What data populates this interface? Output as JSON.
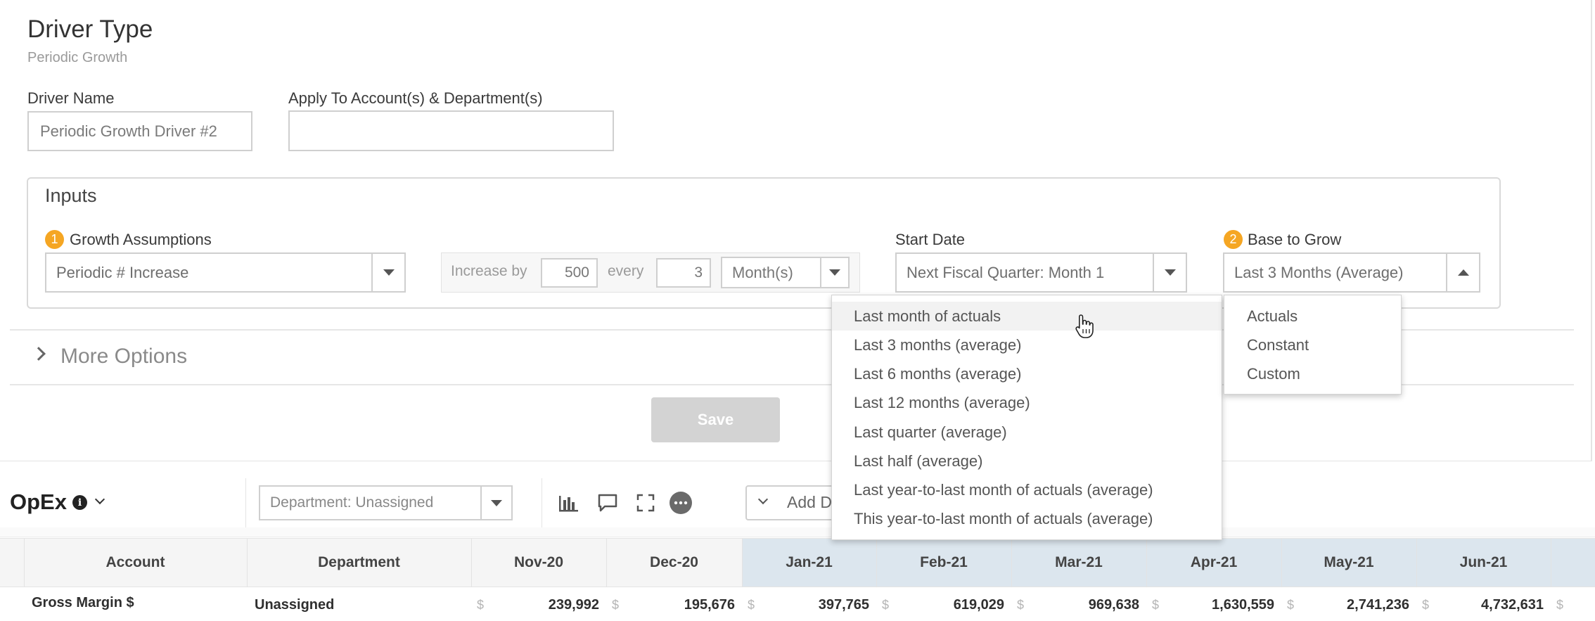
{
  "header": {
    "title": "Driver Type",
    "subtitle": "Periodic Growth"
  },
  "driver_name": {
    "label": "Driver Name",
    "value": "Periodic Growth Driver #2"
  },
  "apply_to": {
    "label": "Apply To Account(s) & Department(s)",
    "value": ""
  },
  "inputs": {
    "heading": "Inputs",
    "growth": {
      "badge": "1",
      "label": "Growth Assumptions",
      "value": "Periodic # Increase"
    },
    "increase": {
      "prefix": "Increase by",
      "amount": "500",
      "every_label": "every",
      "period_count": "3",
      "unit": "Month(s)"
    },
    "start_date": {
      "label": "Start Date",
      "value": "Next Fiscal Quarter: Month 1"
    },
    "base": {
      "badge": "2",
      "label": "Base to Grow",
      "value": "Last 3 Months (Average)"
    }
  },
  "more_options": "More Options",
  "save_label": "Save",
  "base_menu": [
    "Last month of actuals",
    "Last 3 months (average)",
    "Last 6 months (average)",
    "Last 12 months (average)",
    "Last quarter (average)",
    "Last half (average)",
    "Last year-to-last month of actuals (average)",
    "This year-to-last month of actuals (average)"
  ],
  "base_type_menu": [
    "Actuals",
    "Constant",
    "Custom"
  ],
  "opex": {
    "title": "OpEx",
    "department_filter": "Department: Unassigned",
    "add_button": "Add D"
  },
  "colors": {
    "badge": "#f5a623",
    "forecast_header": "#dce6ee",
    "save_disabled": "#d3d3d3"
  },
  "table": {
    "columns": [
      "Account",
      "Department",
      "Nov-20",
      "Dec-20",
      "Jan-21",
      "Feb-21",
      "Mar-21",
      "Apr-21",
      "May-21",
      "Jun-21"
    ],
    "currency": "$",
    "rows": [
      {
        "account": "Gross Margin $",
        "department": "Unassigned",
        "values": [
          "239,992",
          "195,676",
          "397,765",
          "619,029",
          "969,638",
          "1,630,559",
          "2,741,236",
          "4,732,631"
        ]
      }
    ]
  }
}
